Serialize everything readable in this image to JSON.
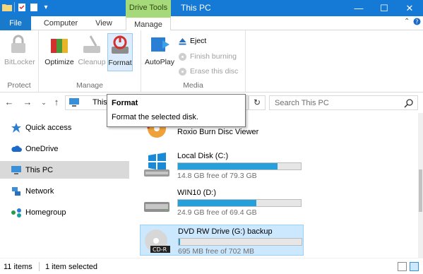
{
  "titlebar": {
    "context_tab": "Drive Tools",
    "title": "This PC",
    "minimize": "—",
    "maximize": "☐",
    "close": "✕"
  },
  "tabs": {
    "file": "File",
    "computer": "Computer",
    "view": "View",
    "manage": "Manage"
  },
  "ribbon": {
    "bitlocker": "BitLocker",
    "optimize": "Optimize",
    "cleanup": "Cleanup",
    "format": "Format",
    "autoplay": "AutoPlay",
    "eject": "Eject",
    "finish_burning": "Finish burning",
    "erase_disc": "Erase this disc",
    "group_protect": "Protect",
    "group_manage": "Manage",
    "group_media": "Media"
  },
  "address": {
    "path": "This PC",
    "search_placeholder": "Search This PC"
  },
  "tooltip": {
    "title": "Format",
    "description": "Format the selected disk."
  },
  "navpane": {
    "items": [
      {
        "label": "Quick access",
        "icon": "star-icon"
      },
      {
        "label": "OneDrive",
        "icon": "cloud-icon"
      },
      {
        "label": "This PC",
        "icon": "computer-icon"
      },
      {
        "label": "Network",
        "icon": "network-icon"
      },
      {
        "label": "Homegroup",
        "icon": "homegroup-icon"
      }
    ]
  },
  "drives": [
    {
      "name": "Roxio Burn Disc Viewer",
      "free": "",
      "used_fraction": null
    },
    {
      "name": "Local Disk (C:)",
      "free": "14.8 GB free of 79.3 GB",
      "used_fraction": 0.81
    },
    {
      "name": "WIN10 (D:)",
      "free": "24.9 GB free of 69.4 GB",
      "used_fraction": 0.64
    },
    {
      "name": "DVD RW Drive (G:) backup",
      "free": "695 MB free of 702 MB",
      "used_fraction": 0.01,
      "badge": "CD-R"
    }
  ],
  "status": {
    "items": "11 items",
    "selected": "1 item selected"
  },
  "colors": {
    "titlebar": "#1579d6",
    "context_tab": "#a6d97a",
    "progress": "#26a0da",
    "selection": "#cce8ff"
  }
}
